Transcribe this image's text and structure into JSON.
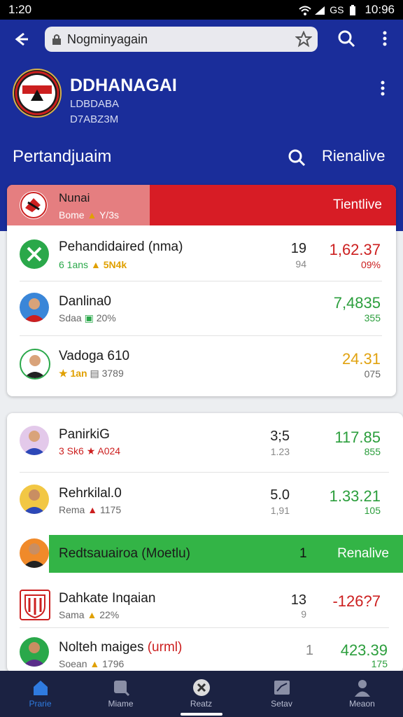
{
  "status_bar": {
    "time": "1:20",
    "right_text": "GS",
    "right_time": "10:96"
  },
  "browser": {
    "url_text": "Nogminyagain"
  },
  "team": {
    "name": "DDHANAGAI",
    "sub1": "LDBDABA",
    "sub2": "D7ABZ3M"
  },
  "section": {
    "title": "Pertandjuaim",
    "link": "Rienalive"
  },
  "card1": {
    "header_name": "Nunai",
    "header_sub": "Bome",
    "header_sub2": "Y/3s",
    "header_action": "Tientlive",
    "rows": [
      {
        "name": "Pehandidaired (nma)",
        "sub_left": "6 1ans",
        "sub_mid": "5N4k",
        "count": "19",
        "count2": "94",
        "value": "1,62.37",
        "pct": "09%",
        "value_color": "#cc1f1f",
        "pct_color": "#cc1f1f"
      },
      {
        "name": "Danlina0",
        "sub_left": "Sdaa",
        "sub_mid": "20%",
        "count": "",
        "count2": "",
        "value": "7,4835",
        "pct": "355",
        "value_color": "#2b9e3c",
        "pct_color": "#2b9e3c"
      },
      {
        "name": "Vadoga 610",
        "sub_left": "1an",
        "sub_mid": "3789",
        "count": "",
        "count2": "",
        "value": "24.31",
        "pct": "075",
        "value_color": "#e1a20f",
        "pct_color": "#666666"
      }
    ]
  },
  "card2": {
    "rows": [
      {
        "name": "PanirkiG",
        "sub_left": "3 Sk6",
        "sub_mid": "A024",
        "count": "3;5",
        "count2": "1.23",
        "value": "117.85",
        "pct": "855",
        "value_color": "#2b9e3c",
        "pct_color": "#2b9e3c"
      },
      {
        "name": "Rehrkilal.0",
        "sub_left": "Rema",
        "sub_mid": "1175",
        "count": "5.0",
        "count2": "1,91",
        "value": "1.33.21",
        "pct": "105",
        "value_color": "#2b9e3c",
        "pct_color": "#2b9e3c"
      },
      {
        "name": "Dahkate Inqaian",
        "sub_left": "Sama",
        "sub_mid": "22%",
        "count": "13",
        "count2": "9",
        "value": "-126?7",
        "pct": "",
        "value_color": "#cc1f1f",
        "pct_color": "#cc1f1f"
      },
      {
        "name": "Nolteh maiges",
        "name_suffix": "(urml)",
        "sub_left": "Soean",
        "sub_mid": "1796",
        "count": "1",
        "count2": "",
        "value": "423.39",
        "pct": "175",
        "value_color": "#2b9e3c",
        "pct_color": "#2b9e3c"
      }
    ],
    "highlight": {
      "name": "Redtsauairoa (Moetlu)",
      "count": "1",
      "action": "Renalive"
    }
  },
  "nav": [
    {
      "label": "Prarie",
      "icon": "home-icon"
    },
    {
      "label": "Miame",
      "icon": "search-icon"
    },
    {
      "label": "Reatz",
      "icon": "soccer-ball-icon"
    },
    {
      "label": "Setav",
      "icon": "stats-icon"
    },
    {
      "label": "Meaon",
      "icon": "profile-icon"
    }
  ],
  "colors": {
    "header_blue": "#1a2d9a",
    "live_red": "#d71c25",
    "live_green": "#33b446",
    "nav_dark": "#1b2242",
    "active_nav": "#2f7be0"
  }
}
